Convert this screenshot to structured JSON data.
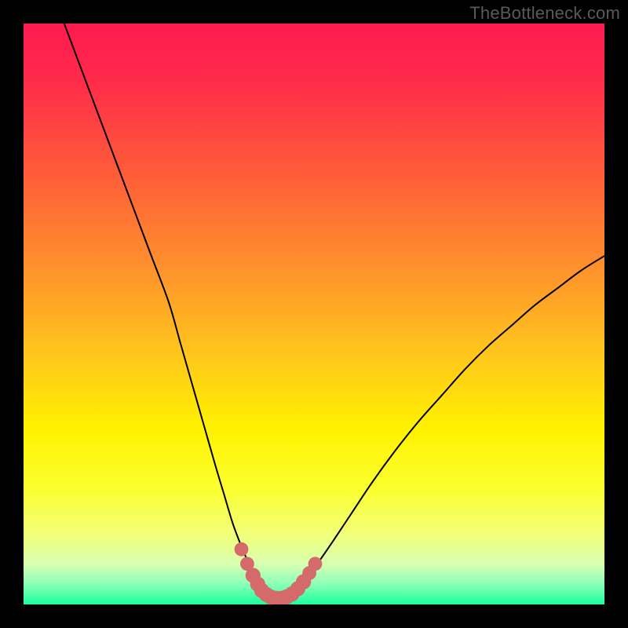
{
  "watermark": "TheBottleneck.com",
  "colors": {
    "frame_bg": "#000000",
    "gradient_stops": [
      {
        "offset": 0.0,
        "color": "#ff1a4f"
      },
      {
        "offset": 0.1,
        "color": "#ff2b4a"
      },
      {
        "offset": 0.25,
        "color": "#ff5a3a"
      },
      {
        "offset": 0.4,
        "color": "#ff8a2e"
      },
      {
        "offset": 0.55,
        "color": "#ffc01f"
      },
      {
        "offset": 0.7,
        "color": "#fff200"
      },
      {
        "offset": 0.8,
        "color": "#fbff2e"
      },
      {
        "offset": 0.88,
        "color": "#f2ff7a"
      },
      {
        "offset": 0.93,
        "color": "#d8ffb0"
      },
      {
        "offset": 0.965,
        "color": "#8cffb8"
      },
      {
        "offset": 1.0,
        "color": "#1aff9e"
      }
    ],
    "curve_stroke": "#000000",
    "marker_fill": "#d46a6a",
    "marker_stroke": "#d46a6a"
  },
  "chart_data": {
    "type": "line",
    "title": "",
    "xlabel": "",
    "ylabel": "",
    "xlim": [
      0,
      100
    ],
    "ylim": [
      0,
      100
    ],
    "series": [
      {
        "name": "bottleneck-curve",
        "x": [
          7,
          10,
          13,
          16,
          19,
          22,
          25,
          27,
          29,
          31,
          33,
          34.5,
          36,
          37.5,
          39,
          40,
          41,
          42,
          43,
          44,
          45,
          46.5,
          48,
          50,
          53,
          56,
          60,
          64,
          68,
          72,
          76,
          80,
          84,
          88,
          92,
          96,
          100
        ],
        "y": [
          100,
          92,
          84,
          76,
          68,
          60,
          52,
          45,
          38,
          31,
          24,
          19,
          14,
          10,
          6.5,
          4.2,
          2.6,
          1.6,
          1.1,
          1.0,
          1.2,
          2.0,
          3.6,
          6.2,
          10.5,
          15.0,
          21.0,
          26.5,
          31.5,
          36.0,
          40.5,
          44.5,
          48.0,
          51.5,
          54.5,
          57.5,
          60.0
        ]
      }
    ],
    "markers": [
      {
        "x": 37.5,
        "y": 9.5,
        "r": 1.2
      },
      {
        "x": 38.5,
        "y": 7.0,
        "r": 1.2
      },
      {
        "x": 39.5,
        "y": 5.0,
        "r": 1.3
      },
      {
        "x": 40.3,
        "y": 3.5,
        "r": 1.3
      },
      {
        "x": 41.0,
        "y": 2.4,
        "r": 1.3
      },
      {
        "x": 41.8,
        "y": 1.7,
        "r": 1.3
      },
      {
        "x": 42.6,
        "y": 1.25,
        "r": 1.3
      },
      {
        "x": 43.5,
        "y": 1.05,
        "r": 1.3
      },
      {
        "x": 44.4,
        "y": 1.05,
        "r": 1.3
      },
      {
        "x": 45.3,
        "y": 1.3,
        "r": 1.3
      },
      {
        "x": 46.2,
        "y": 1.8,
        "r": 1.3
      },
      {
        "x": 47.2,
        "y": 2.7,
        "r": 1.3
      },
      {
        "x": 48.2,
        "y": 3.9,
        "r": 1.3
      },
      {
        "x": 49.2,
        "y": 5.4,
        "r": 1.2
      },
      {
        "x": 50.2,
        "y": 7.0,
        "r": 1.2
      }
    ]
  }
}
